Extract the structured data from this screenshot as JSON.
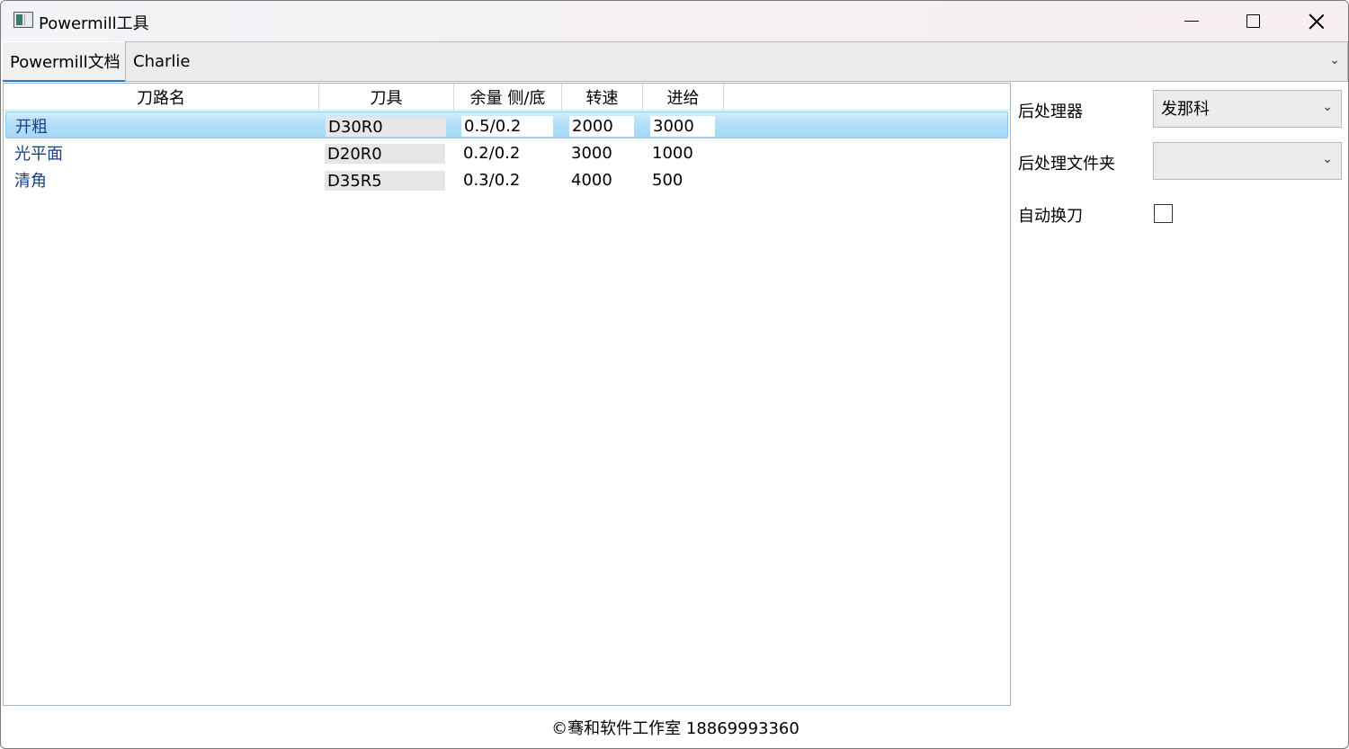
{
  "window": {
    "title": "Powermill工具"
  },
  "document": {
    "label": "Powermill文档",
    "selected": "Charlie"
  },
  "table": {
    "columns": [
      "刀路名",
      "刀具",
      "余量 侧/底",
      "转速",
      "进给"
    ],
    "rows": [
      {
        "name": "开粗",
        "tool": "D30R0",
        "allowance": "0.5/0.2",
        "speed": "2000",
        "feed": "3000"
      },
      {
        "name": "光平面",
        "tool": "D20R0",
        "allowance": "0.2/0.2",
        "speed": "3000",
        "feed": "1000"
      },
      {
        "name": "清角",
        "tool": "D35R5",
        "allowance": "0.3/0.2",
        "speed": "4000",
        "feed": "500"
      }
    ]
  },
  "settings": {
    "post_processor_label": "后处理器",
    "post_processor_value": "发那科",
    "post_folder_label": "后处理文件夹",
    "post_folder_value": "",
    "auto_tool_change_label": "自动换刀"
  },
  "footer": {
    "text": "©骞和软件工作室 18869993360"
  },
  "icons": {
    "dropdown": "chevron-down-icon",
    "app": "app-icon"
  },
  "colors": {
    "selection": "#a6d8f6",
    "name_text": "#1a3f8c",
    "accent": "#2b78c8"
  }
}
